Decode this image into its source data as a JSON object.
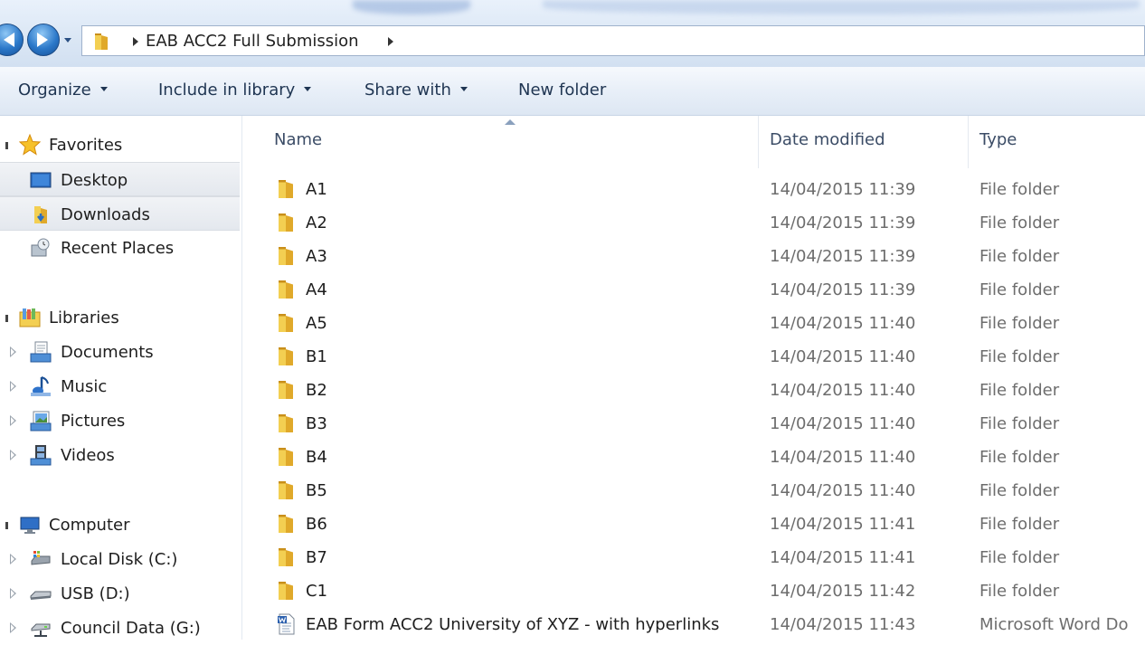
{
  "address": {
    "path_label": "EAB ACC2 Full Submission"
  },
  "toolbar": {
    "organize": "Organize",
    "include_in_library": "Include in library",
    "share_with": "Share with",
    "new_folder": "New folder"
  },
  "nav": {
    "favorites": "Favorites",
    "desktop": "Desktop",
    "downloads": "Downloads",
    "recent_places": "Recent Places",
    "libraries": "Libraries",
    "documents": "Documents",
    "music": "Music",
    "pictures": "Pictures",
    "videos": "Videos",
    "computer": "Computer",
    "local_disk": "Local Disk (C:)",
    "usb": "USB (D:)",
    "council_data": "Council Data (G:)"
  },
  "columns": {
    "name": "Name",
    "date_modified": "Date modified",
    "type": "Type"
  },
  "files": [
    {
      "name": "A1",
      "date": "14/04/2015 11:39",
      "type": "File folder",
      "icon": "folder-icon"
    },
    {
      "name": "A2",
      "date": "14/04/2015 11:39",
      "type": "File folder",
      "icon": "folder-icon"
    },
    {
      "name": "A3",
      "date": "14/04/2015 11:39",
      "type": "File folder",
      "icon": "folder-icon"
    },
    {
      "name": "A4",
      "date": "14/04/2015 11:39",
      "type": "File folder",
      "icon": "folder-icon"
    },
    {
      "name": "A5",
      "date": "14/04/2015 11:40",
      "type": "File folder",
      "icon": "folder-icon"
    },
    {
      "name": "B1",
      "date": "14/04/2015 11:40",
      "type": "File folder",
      "icon": "folder-icon"
    },
    {
      "name": "B2",
      "date": "14/04/2015 11:40",
      "type": "File folder",
      "icon": "folder-icon"
    },
    {
      "name": "B3",
      "date": "14/04/2015 11:40",
      "type": "File folder",
      "icon": "folder-icon"
    },
    {
      "name": "B4",
      "date": "14/04/2015 11:40",
      "type": "File folder",
      "icon": "folder-icon"
    },
    {
      "name": "B5",
      "date": "14/04/2015 11:40",
      "type": "File folder",
      "icon": "folder-icon"
    },
    {
      "name": "B6",
      "date": "14/04/2015 11:41",
      "type": "File folder",
      "icon": "folder-icon"
    },
    {
      "name": "B7",
      "date": "14/04/2015 11:41",
      "type": "File folder",
      "icon": "folder-icon"
    },
    {
      "name": "C1",
      "date": "14/04/2015 11:42",
      "type": "File folder",
      "icon": "folder-icon"
    },
    {
      "name": "EAB Form ACC2 University of XYZ - with hyperlinks",
      "date": "14/04/2015 11:43",
      "type": "Microsoft Word Do",
      "icon": "word-document-icon"
    }
  ],
  "colors": {
    "folder_yellow": "#e8b92d",
    "text_secondary": "#6d6d6d",
    "selection_gray": "#e4e8ee"
  }
}
